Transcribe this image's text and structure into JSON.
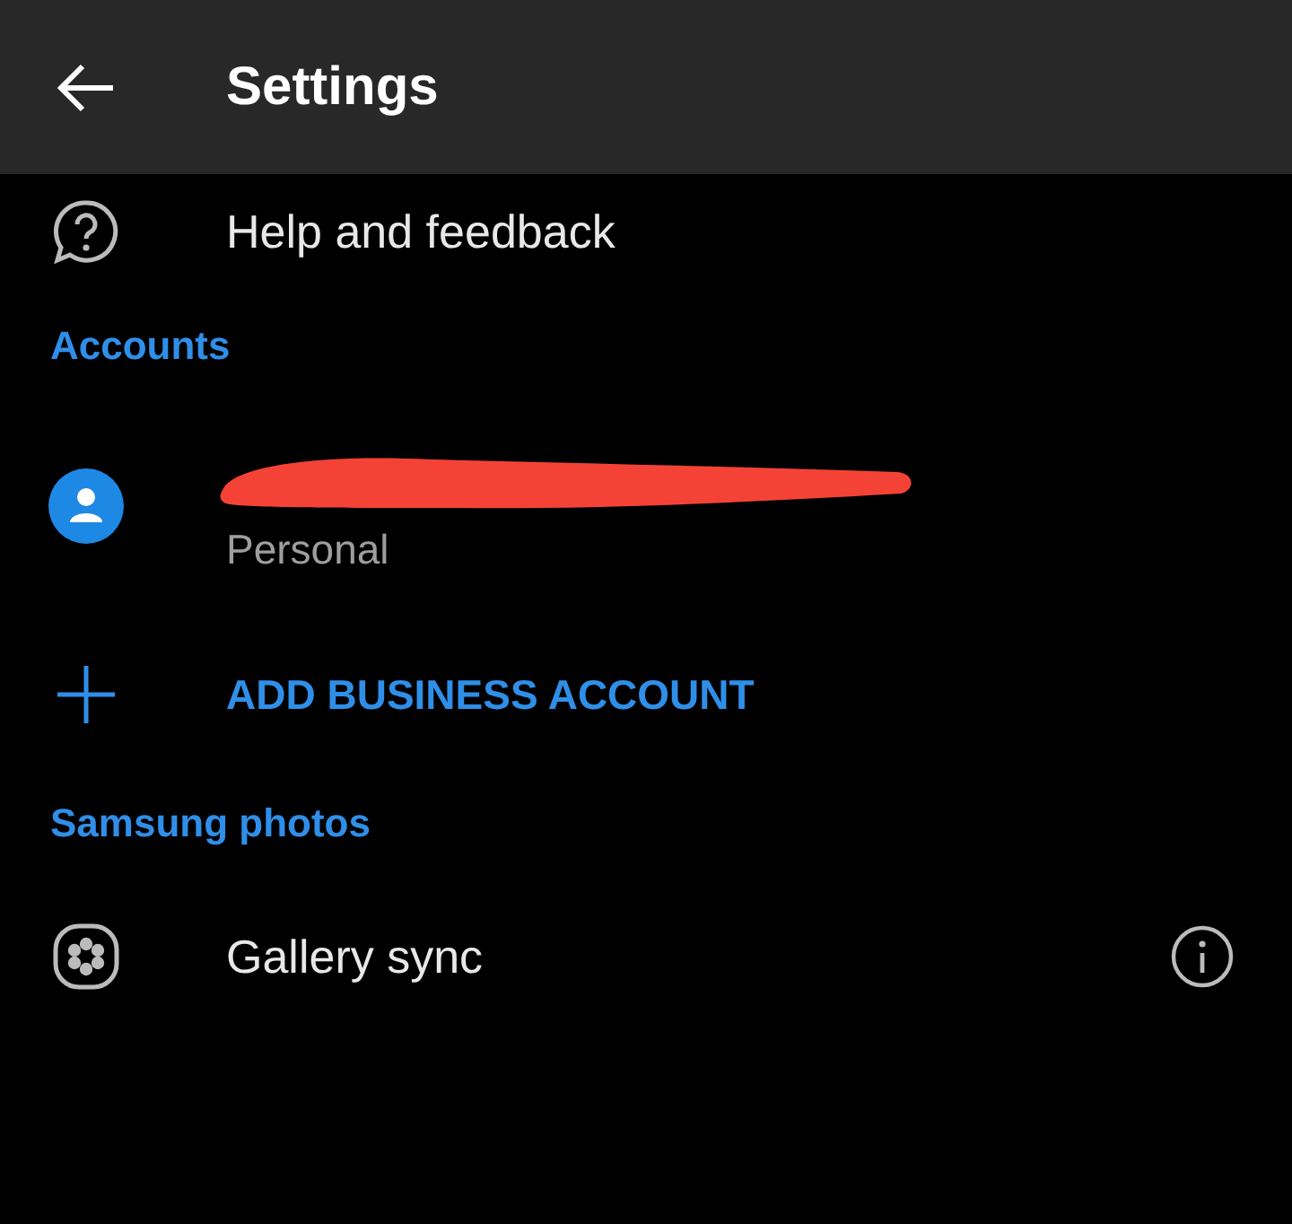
{
  "app_bar": {
    "title": "Settings"
  },
  "sections": [
    {
      "items": [
        {
          "kind": "help",
          "label": "Help and feedback"
        }
      ]
    },
    {
      "header": "Accounts",
      "items": [
        {
          "kind": "account",
          "sublabel": "Personal"
        },
        {
          "kind": "add",
          "label": "ADD BUSINESS ACCOUNT"
        }
      ]
    },
    {
      "header": "Samsung photos",
      "items": [
        {
          "kind": "gallery",
          "label": "Gallery sync",
          "info": true
        }
      ]
    }
  ]
}
